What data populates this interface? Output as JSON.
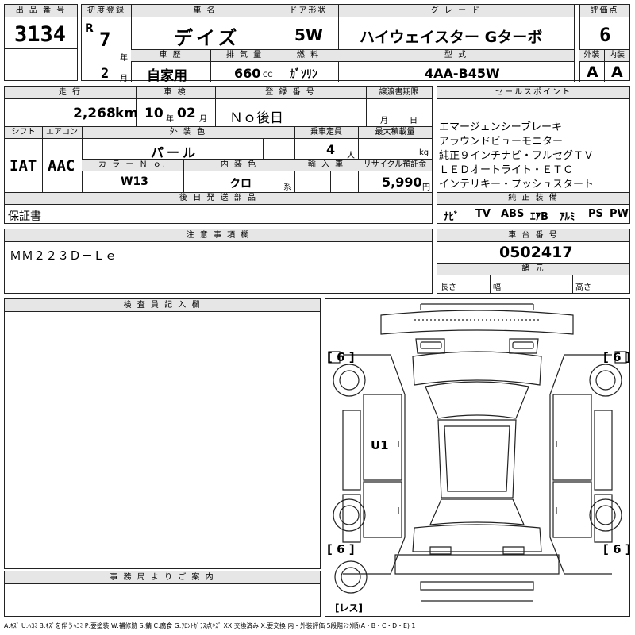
{
  "header": {
    "lot_label": "出 品 番 号",
    "lot_no": "3134",
    "first_reg_label": "初度登録",
    "era": "R",
    "year": "7",
    "year_unit": "年",
    "month": "2",
    "month_unit": "月",
    "car_name_label": "車 名",
    "car_name": "デイズ",
    "door_label": "ドア形状",
    "door": "5W",
    "grade_label": "グ レ ー ド",
    "grade": "ハイウェイスター Gターボ",
    "score_label": "評価点",
    "score": "6",
    "history_label": "車 歴",
    "history": "自家用",
    "displacement_label": "排 気 量",
    "displacement": "660",
    "displacement_unit": "CC",
    "fuel_label": "燃 料",
    "fuel": "ｶﾞｿﾘﾝ",
    "model_label": "型 式",
    "model": "4AA-B45W",
    "exterior_label": "外装",
    "exterior": "A",
    "interior_label": "内装",
    "interior": "A"
  },
  "row2": {
    "mileage_label": "走 行",
    "mileage": "2,268",
    "mileage_unit": "km",
    "inspection_label": "車 検",
    "insp_year": "10",
    "insp_year_unit": "年",
    "insp_month": "02",
    "insp_month_unit": "月",
    "plate_label": "登 録 番 号",
    "plate": "Ｎｏ後日",
    "transfer_label": "譲渡書期限",
    "transfer_month": "月",
    "transfer_day": "日",
    "shift_label": "シフト",
    "shift": "IAT",
    "ac_label": "エアコン",
    "ac": "AAC",
    "color_label": "外 装 色",
    "color": "パール",
    "capacity_label": "乗車定員",
    "capacity": "4",
    "capacity_unit": "人",
    "load_label": "最大積載量",
    "load_unit": "kg",
    "color_no_label": "カ ラ ー Ｎ ｏ.",
    "color_no": "W13",
    "int_color_label": "内 装 色",
    "int_color": "クロ",
    "int_color_unit": "系",
    "import_label": "輸 入 車",
    "recycle_label": "リサイクル預託金",
    "recycle": "5,990",
    "recycle_unit": "円",
    "parts_label": "後 日 発 送 部 品",
    "parts": "保証書"
  },
  "sales": {
    "label": "セールスポイント",
    "points": [
      "エマージェンシーブレーキ",
      "アラウンドビューモニター",
      "純正９インチナビ・フルセグＴＶ",
      "ＬＥＤオートライト・ＥＴＣ",
      "インテリキー・プッシュスタート"
    ],
    "equip_label": "純 正 装 備",
    "equipment": [
      "ﾅﾋﾞ",
      "TV",
      "ABS",
      "ｴｱB",
      "ｱﾙﾐ",
      "PS",
      "PW"
    ]
  },
  "notes": {
    "label": "注 意 事 項 欄",
    "text": "ＭＭ２２３Ｄ－Ｌｅ"
  },
  "chassis": {
    "label": "車 台 番 号",
    "number": "0502417",
    "specs_label": "諸 元",
    "length_label": "長さ",
    "width_label": "幅",
    "height_label": "高さ"
  },
  "inspector": {
    "label": "検 査 員 記 入 欄"
  },
  "office": {
    "label": "事 務 局 よ り ご 案 内"
  },
  "diagram": {
    "tire_fl": "[ 6 ]",
    "tire_fr": "[ 6 ]",
    "tire_rl": "[ 6 ]",
    "tire_rr": "[ 6 ]",
    "damage_mark": "U1",
    "spare": "[レス]"
  },
  "legend": "A:ｷｽﾞ U:ﾍｺﾐ B:ｷｽﾞを伴うﾍｺﾐ P:要塗装 W:補修跡 S:錆 C:腐食 G:ﾌﾛﾝﾄｶﾞﾗｽ点ｷｽﾞ XX:交換済み X:要交換 内・外装評価 5段階ﾗﾝｸ順(A・B・C・D・E) 1"
}
